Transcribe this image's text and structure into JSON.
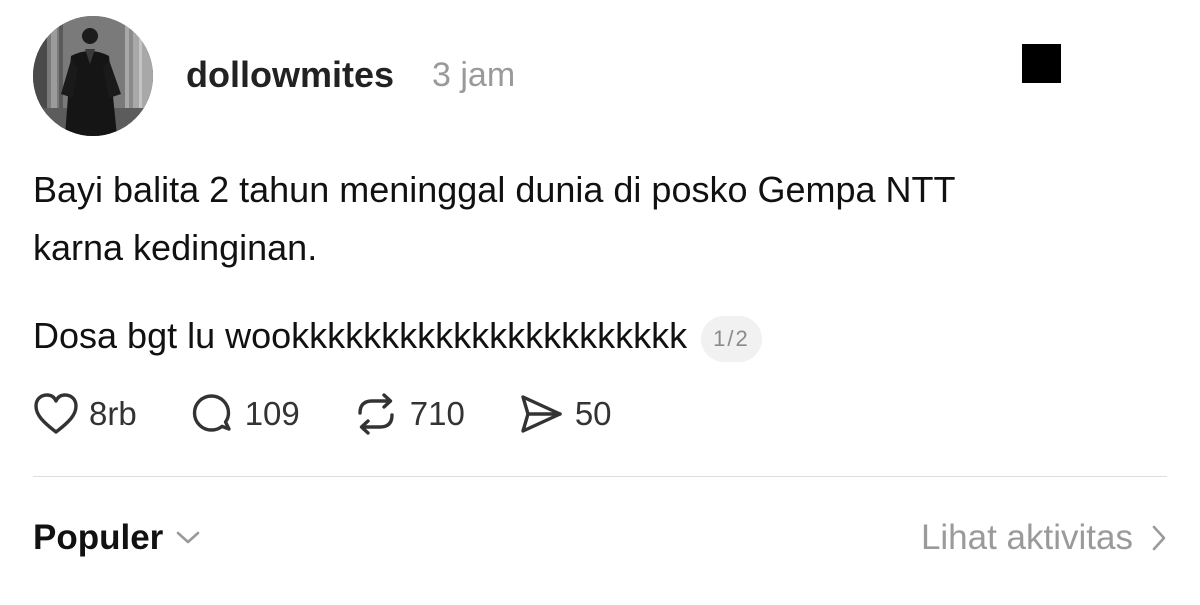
{
  "post": {
    "username": "dollowmites",
    "time": "3 jam",
    "text_line1": "Bayi balita 2 tahun meninggal dunia di posko Gempa NTT",
    "text_line2": "karna kedinginan.",
    "text_line3": "Dosa bgt lu wookkkkkkkkkkkkkkkkkkkkkk",
    "page_indicator": "1/2"
  },
  "actions": {
    "likes": "8rb",
    "replies": "109",
    "reposts": "710",
    "shares": "50"
  },
  "footer": {
    "sort_label": "Populer",
    "activity_label": "Lihat aktivitas"
  },
  "icons": {
    "avatar": "profile-photo",
    "more": "redacted-square",
    "like": "heart-icon",
    "reply": "speech-bubble-icon",
    "repost": "repost-arrows-icon",
    "share": "paper-plane-icon",
    "sort": "chevron-down-icon",
    "activity": "chevron-right-icon"
  }
}
